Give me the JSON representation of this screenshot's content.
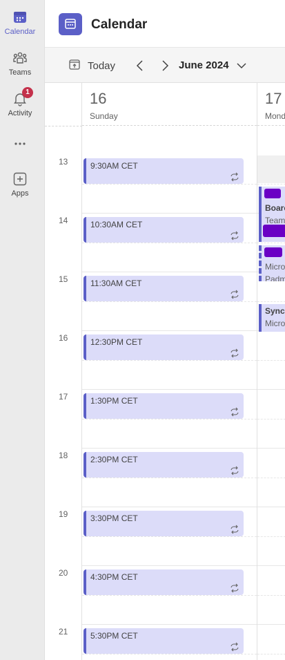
{
  "rail": {
    "items": [
      {
        "label": "Calendar",
        "icon": "calendar-icon",
        "active": true
      },
      {
        "label": "Teams",
        "icon": "teams-icon",
        "active": false
      },
      {
        "label": "Activity",
        "icon": "bell-icon",
        "active": false,
        "badge": "1"
      },
      {
        "label": "",
        "icon": "more-icon",
        "active": false
      },
      {
        "label": "Apps",
        "icon": "apps-add-icon",
        "active": false
      }
    ]
  },
  "header": {
    "title": "Calendar",
    "icon": "calendar-app-icon"
  },
  "toolbar": {
    "today_label": "Today",
    "month_label": "June 2024"
  },
  "days": [
    {
      "number": "16",
      "name": "Sunday"
    },
    {
      "number": "17",
      "name": "Mond"
    }
  ],
  "hours": [
    "13",
    "14",
    "15",
    "16",
    "17",
    "18",
    "19",
    "20",
    "21"
  ],
  "sunday_events": [
    {
      "title": "9:30AM CET"
    },
    {
      "title": "10:30AM CET"
    },
    {
      "title": "11:30AM CET"
    },
    {
      "title": "12:30PM CET"
    },
    {
      "title": "1:30PM CET"
    },
    {
      "title": "2:30PM CET"
    },
    {
      "title": "3:30PM CET"
    },
    {
      "title": "4:30PM CET"
    },
    {
      "title": "5:30PM CET"
    }
  ],
  "monday_events": {
    "event1": {
      "line2": "Boarc",
      "line3": "Teams"
    },
    "event2": {
      "line2": "Micro",
      "line3": "Padm"
    },
    "event3": {
      "line1": "Sync",
      "line2": "Micro"
    }
  },
  "colors": {
    "accent": "#5b5fc7",
    "event_bg": "#dcdcf9",
    "badge": "#c4314b",
    "redaction": "#6a00c4"
  }
}
